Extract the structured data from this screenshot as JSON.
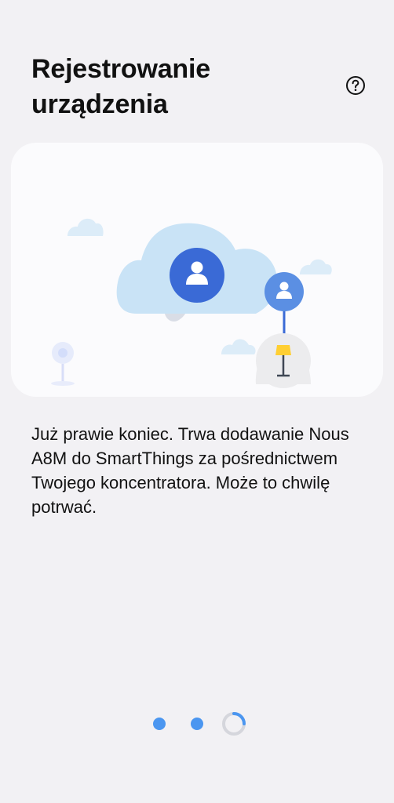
{
  "header": {
    "title": "Rejestrowanie\nurządzenia",
    "help_icon": "help-icon"
  },
  "illustration": {
    "icons": [
      "cloud-icon",
      "user-icon",
      "lamp-icon",
      "hub-icon"
    ]
  },
  "description": "Już prawie koniec. Trwa dodawanie Nous A8M do SmartThings za pośrednictwem Twojego koncentratora. Może to chwilę potrwać.",
  "progress": {
    "completed_steps": 2,
    "current_step_loading": true
  },
  "colors": {
    "background": "#f2f1f4",
    "card": "#fbfbfd",
    "accent": "#4b96f0",
    "cloud": "#c9e3f6",
    "user_badge_dark": "#3a6ad6",
    "user_badge_light": "#5b8fe3",
    "lamp_shade": "#ffcf33"
  }
}
